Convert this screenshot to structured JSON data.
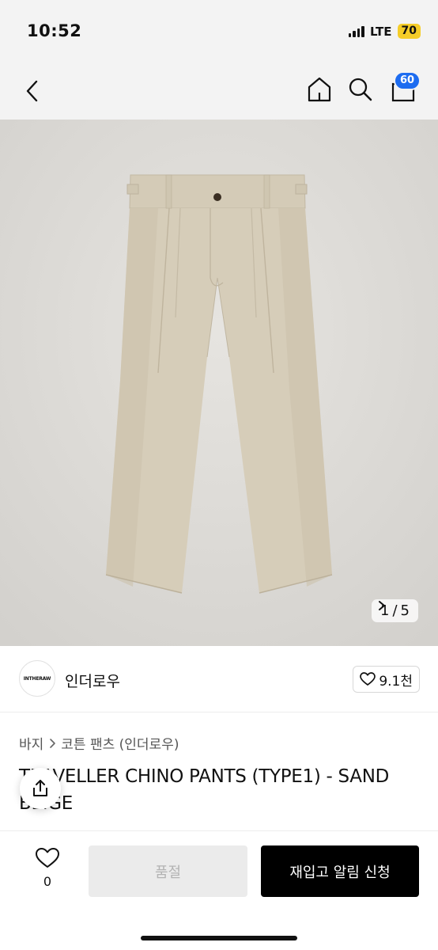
{
  "status_bar": {
    "time": "10:52",
    "network": "LTE",
    "battery": "70"
  },
  "nav": {
    "cart_count": "60"
  },
  "gallery": {
    "current": "1",
    "separator": "/",
    "total": "5"
  },
  "brand": {
    "logo_text": "INTHERAW",
    "name": "인더로우",
    "likes": "9.1천"
  },
  "breadcrumb": {
    "category": "바지",
    "subcategory": "코튼 팬츠 (인더로우)"
  },
  "product": {
    "title": "TRAVELLER CHINO PANTS (TYPE1) - SAND BEIGE"
  },
  "bottom_bar": {
    "wish_count": "0",
    "soldout_label": "품절",
    "restock_label": "재입고 알림 신청"
  },
  "colors": {
    "accent_badge": "#1d6cf0",
    "battery": "#f5cd28",
    "photo_bg": "#dcdad6",
    "pants": "#d6cdb9"
  },
  "icons": [
    "back-icon",
    "home-icon",
    "search-icon",
    "cart-icon",
    "heart-icon",
    "share-icon",
    "chevron-right-icon"
  ]
}
